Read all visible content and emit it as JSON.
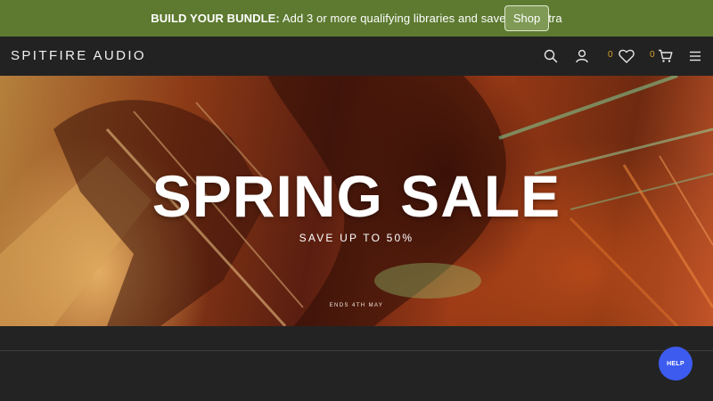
{
  "promo": {
    "bold_text": "BUILD YOUR BUNDLE:",
    "text": " Add 3 or more qualifying libraries and save 10% extra",
    "shop_label": "Shop"
  },
  "nav": {
    "logo": "SPITFIRE AUDIO",
    "wishlist_count": "0",
    "cart_count": "0",
    "icons": [
      "search-icon",
      "user-icon",
      "heart-icon",
      "cart-icon",
      "menu-icon"
    ]
  },
  "hero": {
    "title": "SPRING SALE",
    "subtitle": "SAVE UP TO 50%",
    "ends": "ENDS 4TH MAY"
  },
  "help": {
    "label": "HELP"
  },
  "colors": {
    "promo_bg": "#5d7a30",
    "nav_bg": "#222222",
    "count_accent": "#d8a42c",
    "help_bg": "#3d5bef"
  }
}
